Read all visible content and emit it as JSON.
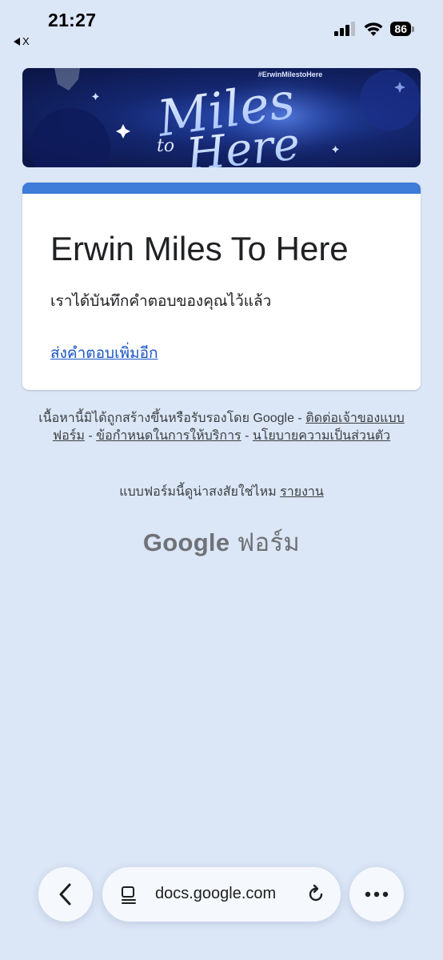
{
  "status_bar": {
    "time": "21:27",
    "back_app": "X",
    "battery": "86"
  },
  "banner": {
    "hashtag": "#ErwinMilestoHere",
    "word_miles": "Miles",
    "word_to": "to",
    "word_here": "Here"
  },
  "form": {
    "title": "Erwin Miles To Here",
    "confirmation_message": "เราได้บันทึกคำตอบของคุณไว้แล้ว",
    "submit_another_link": "ส่งคำตอบเพิ่มอีก",
    "accent_color": "#3f7bd8"
  },
  "footer": {
    "disclaimer_prefix": "เนื้อหานี้มิได้ถูกสร้างขึ้นหรือรับรองโดย Google -",
    "contact_owner_link": "ติดต่อเจ้าของแบบฟอร์ม",
    "separator": "-",
    "terms_link": "ข้อกำหนดในการให้บริการ",
    "privacy_link": "นโยบายความเป็นส่วนตัว",
    "report_prefix": "แบบฟอร์มนี้ดูน่าสงสัยใช่ไหม",
    "report_link": "รายงาน",
    "logo_brand": "Google",
    "logo_product": "ฟอร์ม"
  },
  "browser_toolbar": {
    "url": "docs.google.com",
    "back_icon": "chevron-left-icon",
    "page_icon": "page-menu-icon",
    "reload_icon": "reload-icon",
    "more_icon": "more-horizontal-icon"
  }
}
